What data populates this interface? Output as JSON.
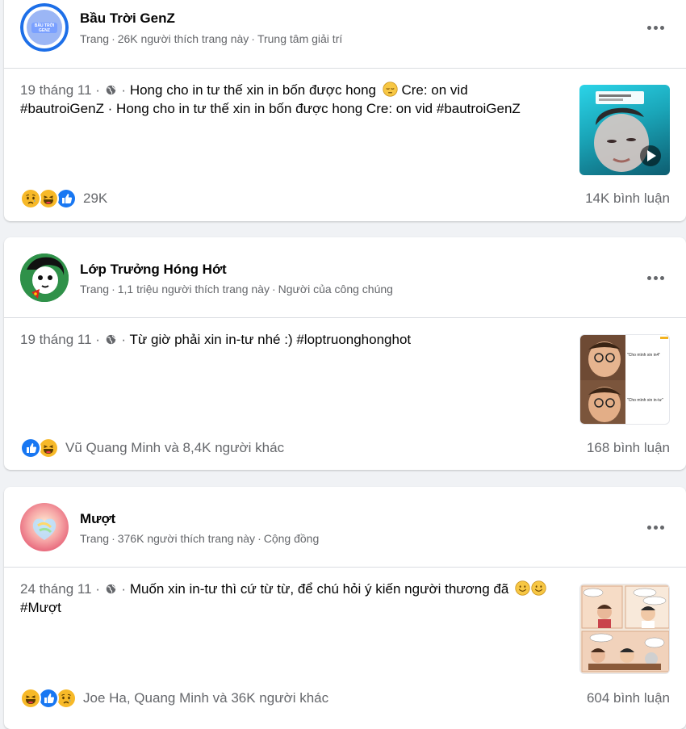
{
  "posts": [
    {
      "page_name": "Bầu Trời GenZ",
      "meta_type": "Trang",
      "meta_likes": "26K người thích trang này",
      "meta_category": "Trung tâm giải trí",
      "date": "19 tháng 11",
      "text": "Hong cho in tư thế xin in bốn được hong",
      "text_after_emoji": "Cre: on vid",
      "text_line2": "#bautroiGenZ · Hong cho in tư thế xin in bốn được hong Cre: on vid #bautroiGenZ",
      "reaction_icons": [
        "sad-reaction-icon",
        "haha-reaction-icon",
        "like-reaction-icon"
      ],
      "reaction_count": "29K",
      "comments": "14K bình luận",
      "avatar_label": "BẦU TRỜI GENZ"
    },
    {
      "page_name": "Lớp Trưởng Hóng Hớt",
      "meta_type": "Trang",
      "meta_likes": "1,1 triệu người thích trang này",
      "meta_category": "Người của công chúng",
      "date": "19 tháng 11",
      "text": "Từ giờ phải xin in-tư nhé :) #loptruonghonghot",
      "reaction_icons": [
        "like-reaction-icon",
        "haha-reaction-icon"
      ],
      "reaction_count": "Vũ Quang Minh và 8,4K người khác",
      "comments": "168 bình luận",
      "thumb_caption_top": "\"Cho mình xin in4\"",
      "thumb_caption_bottom": "\"Cho mình xin in-tư\""
    },
    {
      "page_name": "Mượt",
      "meta_type": "Trang",
      "meta_likes": "376K người thích trang này",
      "meta_category": "Cộng đồng",
      "date": "24 tháng 11",
      "text": "Muốn xin in-tư thì cứ từ từ, để chú hỏi ý kiến người thương đã",
      "text_line2": "#Mượt",
      "reaction_icons": [
        "haha-reaction-icon",
        "like-reaction-icon",
        "sad-reaction-icon"
      ],
      "reaction_count": "Joe Ha, Quang Minh và 36K người khác",
      "comments": "604 bình luận"
    }
  ],
  "separator": "·",
  "colors": {
    "background": "#f0f2f5",
    "secondary_text": "#65676b",
    "like_blue": "#1877f2",
    "emoji_yellow": "#f7b928"
  }
}
